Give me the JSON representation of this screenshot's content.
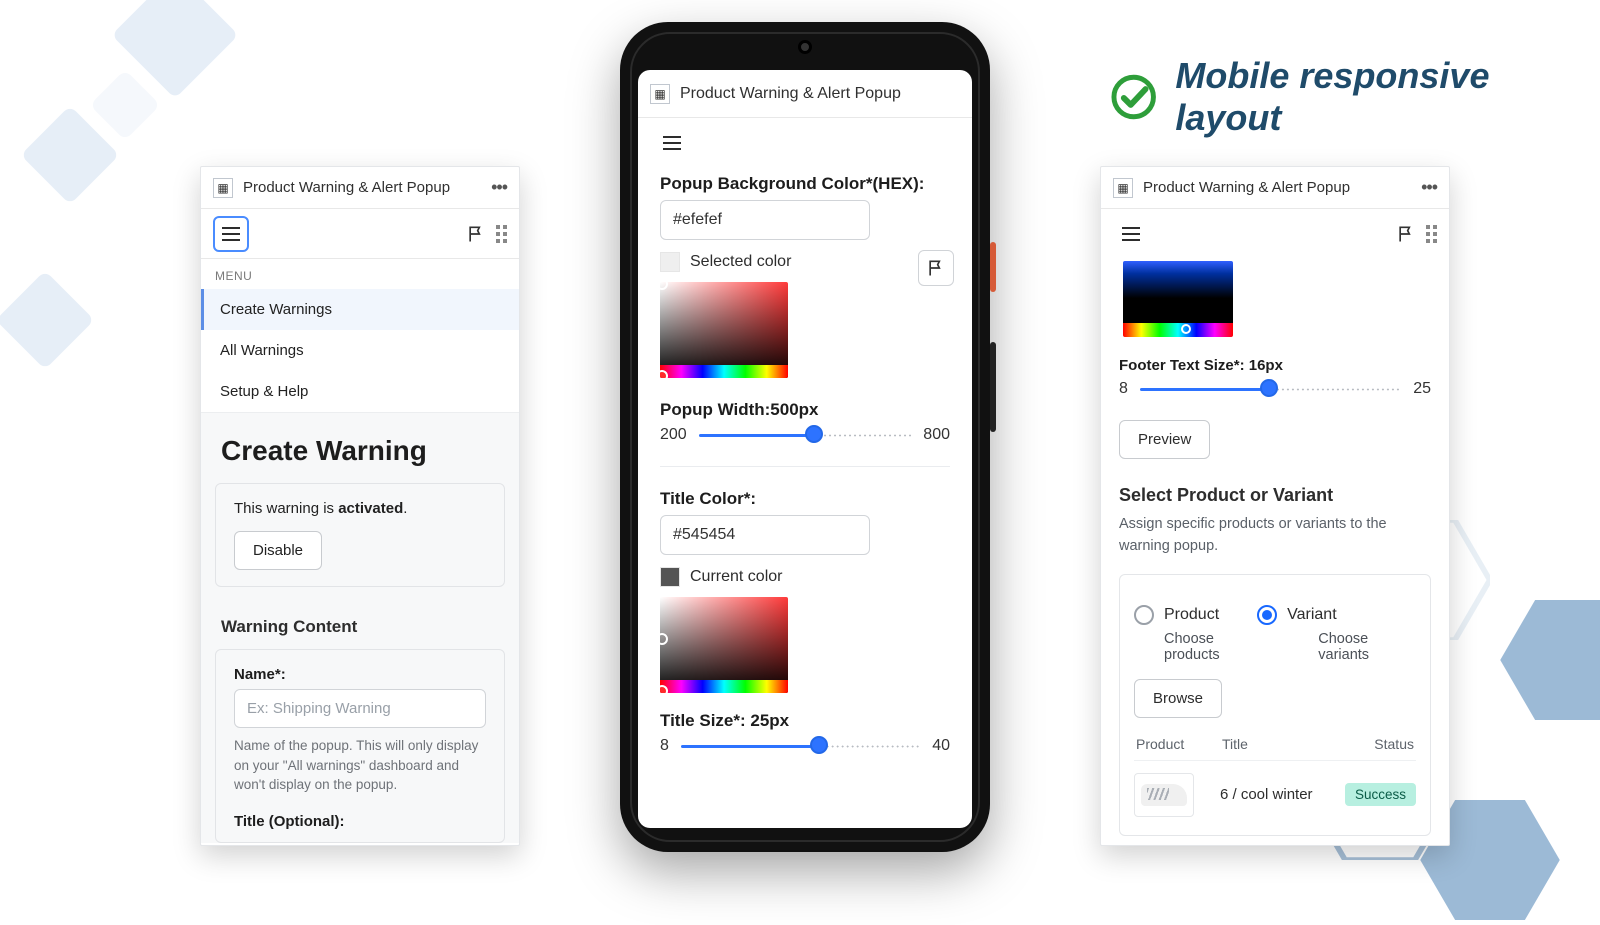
{
  "app_title": "Product Warning & Alert Popup",
  "headline": "Mobile responsive layout",
  "panelA": {
    "menu_caption": "MENU",
    "menu_items": [
      "Create Warnings",
      "All Warnings",
      "Setup & Help"
    ],
    "page_title": "Create Warning",
    "activation_prefix": "This warning is ",
    "activation_state": "activated",
    "disable_btn": "Disable",
    "section_content": "Warning Content",
    "name_label": "Name*:",
    "name_placeholder": "Ex: Shipping Warning",
    "name_help": "Name of the popup. This will only display on your \"All warnings\" dashboard and won't display on the popup.",
    "title_label": "Title (Optional):"
  },
  "phone": {
    "bg_label": "Popup Background Color*(HEX):",
    "bg_value": "#efefef",
    "selected_color": "Selected color",
    "width_label": "Popup Width:500px",
    "width_min": "200",
    "width_max": "800",
    "title_color_label": "Title Color*:",
    "title_color_value": "#545454",
    "current_color": "Current color",
    "title_size_label": "Title Size*: 25px",
    "size_min": "8",
    "size_max": "40"
  },
  "panelC": {
    "footer_label": "Footer Text Size*: 16px",
    "footer_min": "8",
    "footer_max": "25",
    "preview_btn": "Preview",
    "select_heading": "Select Product or Variant",
    "select_desc": "Assign specific products or variants to the warning popup.",
    "radio_product": "Product",
    "radio_variant": "Variant",
    "sub_product": "Choose products",
    "sub_variant": "Choose variants",
    "browse_btn": "Browse",
    "th_product": "Product",
    "th_title": "Title",
    "th_status": "Status",
    "row_title": "6 / cool winter",
    "row_status": "Success"
  }
}
